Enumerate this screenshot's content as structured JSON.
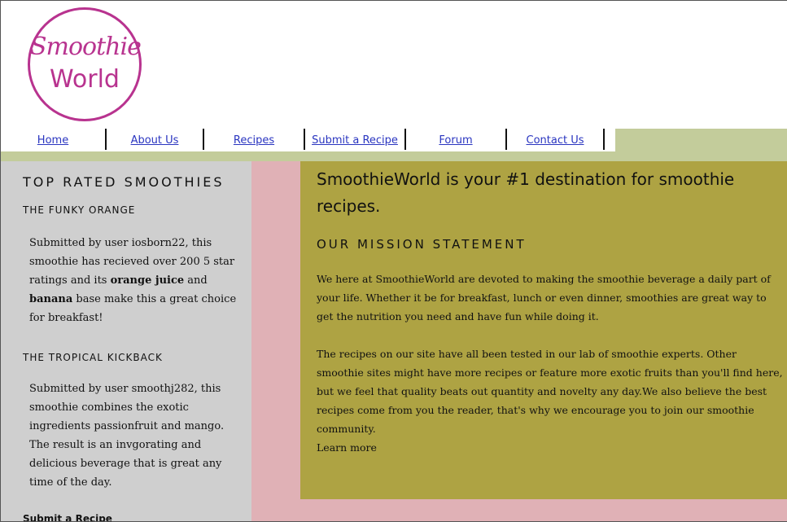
{
  "logo": {
    "line1": "Smoothie",
    "line2": "World"
  },
  "nav": {
    "items": [
      "Home",
      "About Us",
      "Recipes",
      "Submit a Recipe",
      "Forum",
      "Contact Us"
    ]
  },
  "sidebar": {
    "title": "TOP RATED SMOOTHIES",
    "item1": {
      "title": "THE FUNKY ORANGE",
      "text_a": "Submitted by user iosborn22, this smoothie has recieved over 200 5 star ratings and its ",
      "bold_a": "orange juice",
      "text_b": " and ",
      "bold_b": "banana",
      "text_c": " base make this a great choice for breakfast!"
    },
    "item2": {
      "title": "THE TROPICAL KICKBACK",
      "text": "Submitted by user smoothj282, this smoothie combines the exotic ingredients passionfruit and mango. The result is an invgorating and delicious beverage that is great any time of the day."
    },
    "submit_link": "Submit a Recipe"
  },
  "main": {
    "heading": "SmoothieWorld is your #1 destination for smoothie recipes.",
    "mission_title": "OUR MISSION STATEMENT",
    "para1": "We here at SmoothieWorld are devoted to making the smoothie beverage a daily part of your life. Whether it be for breakfast, lunch or even dinner, smoothies are great way to get the nutrition you need and have fun while doing it.",
    "para2": "The recipes on our site have all been tested in our lab of smoothie experts. Other smoothie sites might have more recipes or feature more exotic fruits than you'll find here, but we feel that quality beats out quantity and novelty any day.We also believe the best recipes come from you the reader, that's why we encourage you to join our smoothie community.",
    "learn_more": "Learn more"
  },
  "colors": {
    "brand": "#b8338f",
    "nav_band": "#c3cc9b",
    "sidebar_bg": "#cfcfcf",
    "page_bg": "#e0b1b6",
    "main_bg": "#aea343",
    "link": "#2a35c0"
  }
}
